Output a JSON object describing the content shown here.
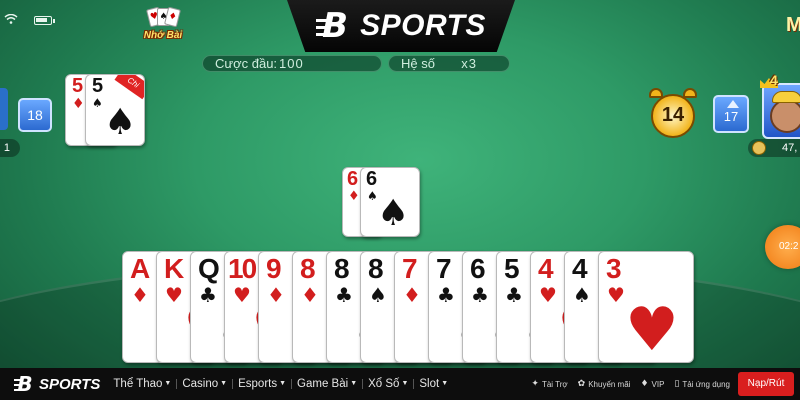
{
  "brand": {
    "name": "SPORTS",
    "logo_letter": "B"
  },
  "memory_badge": {
    "label": "Nhớ Bài",
    "cards": [
      "♥",
      "♠",
      "♦"
    ]
  },
  "bet": {
    "label": "Cược đầu:",
    "value": "100"
  },
  "coefficient": {
    "label": "Hệ số",
    "value": "x3"
  },
  "left_player": {
    "card_count": "18",
    "money": "1"
  },
  "left_last_play": {
    "badge": "Chi",
    "cards": [
      {
        "rank": "5",
        "suit": "♦"
      },
      {
        "rank": "5",
        "suit": "♠"
      }
    ]
  },
  "right_player": {
    "card_count": "17",
    "money": "47,",
    "countdown": "14",
    "vip_level": "4",
    "corner_glyph": "M"
  },
  "center_play": {
    "cards": [
      {
        "rank": "6",
        "suit": "♦"
      },
      {
        "rank": "6",
        "suit": "♠"
      }
    ]
  },
  "timer": {
    "text": "02:2"
  },
  "hand": {
    "cards": [
      {
        "rank": "A",
        "suit": "♦",
        "color": "red"
      },
      {
        "rank": "K",
        "suit": "♥",
        "color": "red"
      },
      {
        "rank": "Q",
        "suit": "♣",
        "color": "black"
      },
      {
        "rank": "10",
        "suit": "♥",
        "color": "red"
      },
      {
        "rank": "9",
        "suit": "♦",
        "color": "red"
      },
      {
        "rank": "8",
        "suit": "♦",
        "color": "red"
      },
      {
        "rank": "8",
        "suit": "♣",
        "color": "black"
      },
      {
        "rank": "8",
        "suit": "♠",
        "color": "black"
      },
      {
        "rank": "7",
        "suit": "♦",
        "color": "red"
      },
      {
        "rank": "7",
        "suit": "♣",
        "color": "black"
      },
      {
        "rank": "6",
        "suit": "♣",
        "color": "black"
      },
      {
        "rank": "5",
        "suit": "♣",
        "color": "black"
      },
      {
        "rank": "4",
        "suit": "♥",
        "color": "red"
      },
      {
        "rank": "4",
        "suit": "♠",
        "color": "black"
      },
      {
        "rank": "3",
        "suit": "♥",
        "color": "red"
      }
    ]
  },
  "nav": {
    "logo_text": "SPORTS",
    "menu": [
      {
        "label": "Thể Thao",
        "dropdown": true
      },
      {
        "label": "Casino",
        "dropdown": true
      },
      {
        "label": "Esports",
        "dropdown": true
      },
      {
        "label": "Game Bài",
        "dropdown": true
      },
      {
        "label": "Xổ Số",
        "dropdown": true
      },
      {
        "label": "Slot",
        "dropdown": true
      }
    ],
    "utilities": [
      {
        "icon": "sponsor-icon",
        "glyph": "✦",
        "label": "Tài Trợ"
      },
      {
        "icon": "promotion-icon",
        "glyph": "✿",
        "label": "Khuyến mãi"
      },
      {
        "icon": "vip-icon",
        "glyph": "♦",
        "label": "VIP"
      },
      {
        "icon": "download-icon",
        "glyph": "▯",
        "label": "Tải ứng dụng"
      }
    ],
    "cta": "Nạp/Rút"
  },
  "colors": {
    "table_green": "#2e9a66",
    "nav_bg": "#0d0d0d",
    "cta_red": "#d91e1e",
    "card_red": "#d21e1e"
  }
}
